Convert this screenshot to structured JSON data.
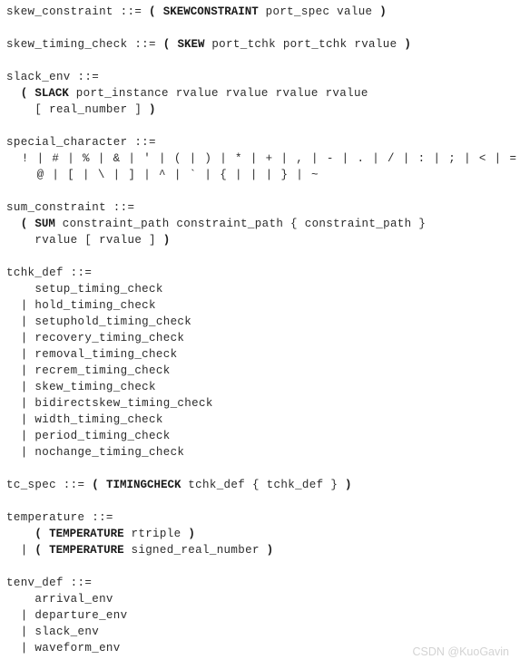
{
  "document": {
    "type": "bnf-grammar-listing",
    "watermark": "CSDN @KuoGavin",
    "text_color": "#2b2b2b",
    "keyword_color": "#1a1a1a",
    "background_color": "#ffffff",
    "lines": [
      {
        "id": "l1",
        "indent": 0,
        "segments": [
          {
            "t": "skew_constraint ::= ",
            "b": false
          },
          {
            "t": "(",
            "b": true
          },
          {
            "t": " ",
            "b": false
          },
          {
            "t": "SKEWCONSTRAINT",
            "b": true
          },
          {
            "t": " port_spec value ",
            "b": false
          },
          {
            "t": ")",
            "b": true
          }
        ]
      },
      {
        "id": "l2",
        "indent": 0,
        "segments": []
      },
      {
        "id": "l3",
        "indent": 0,
        "segments": [
          {
            "t": "skew_timing_check ::= ",
            "b": false
          },
          {
            "t": "(",
            "b": true
          },
          {
            "t": " ",
            "b": false
          },
          {
            "t": "SKEW",
            "b": true
          },
          {
            "t": " port_tchk port_tchk rvalue ",
            "b": false
          },
          {
            "t": ")",
            "b": true
          }
        ]
      },
      {
        "id": "l4",
        "indent": 0,
        "segments": []
      },
      {
        "id": "l5",
        "indent": 0,
        "segments": [
          {
            "t": "slack_env ::=",
            "b": false
          }
        ]
      },
      {
        "id": "l6",
        "indent": 0,
        "segments": [
          {
            "t": "  ",
            "b": false
          },
          {
            "t": "(",
            "b": true
          },
          {
            "t": " ",
            "b": false
          },
          {
            "t": "SLACK",
            "b": true
          },
          {
            "t": " port_instance rvalue rvalue rvalue rvalue",
            "b": false
          }
        ]
      },
      {
        "id": "l7",
        "indent": 0,
        "segments": [
          {
            "t": "    [ real_number ] ",
            "b": false
          },
          {
            "t": ")",
            "b": true
          }
        ]
      },
      {
        "id": "l8",
        "indent": 0,
        "segments": []
      },
      {
        "id": "l9",
        "indent": 0,
        "segments": [
          {
            "t": "special_character ::=",
            "b": false
          }
        ]
      },
      {
        "id": "l10",
        "indent": 0,
        "special": true,
        "segments": [
          {
            "t": "  ! | # | % | & | ' | ( | ) | * | + | , | - | . | / | : | ; | < | = | > | ? |",
            "b": false
          }
        ]
      },
      {
        "id": "l11",
        "indent": 0,
        "special": true,
        "segments": [
          {
            "t": "    @ | [ | \\ | ] | ^ | ` | { | | | } | ~",
            "b": false
          }
        ]
      },
      {
        "id": "l12",
        "indent": 0,
        "segments": []
      },
      {
        "id": "l13",
        "indent": 0,
        "segments": [
          {
            "t": "sum_constraint ::=",
            "b": false
          }
        ]
      },
      {
        "id": "l14",
        "indent": 0,
        "segments": [
          {
            "t": "  ",
            "b": false
          },
          {
            "t": "(",
            "b": true
          },
          {
            "t": " ",
            "b": false
          },
          {
            "t": "SUM",
            "b": true
          },
          {
            "t": " constraint_path constraint_path { constraint_path }",
            "b": false
          }
        ]
      },
      {
        "id": "l15",
        "indent": 0,
        "segments": [
          {
            "t": "    rvalue [ rvalue ] ",
            "b": false
          },
          {
            "t": ")",
            "b": true
          }
        ]
      },
      {
        "id": "l16",
        "indent": 0,
        "segments": []
      },
      {
        "id": "l17",
        "indent": 0,
        "segments": [
          {
            "t": "tchk_def ::=",
            "b": false
          }
        ]
      },
      {
        "id": "l18",
        "indent": 0,
        "segments": [
          {
            "t": "    setup_timing_check",
            "b": false
          }
        ]
      },
      {
        "id": "l19",
        "indent": 0,
        "segments": [
          {
            "t": "  | hold_timing_check",
            "b": false
          }
        ]
      },
      {
        "id": "l20",
        "indent": 0,
        "segments": [
          {
            "t": "  | setuphold_timing_check",
            "b": false
          }
        ]
      },
      {
        "id": "l21",
        "indent": 0,
        "segments": [
          {
            "t": "  | recovery_timing_check",
            "b": false
          }
        ]
      },
      {
        "id": "l22",
        "indent": 0,
        "segments": [
          {
            "t": "  | removal_timing_check",
            "b": false
          }
        ]
      },
      {
        "id": "l23",
        "indent": 0,
        "segments": [
          {
            "t": "  | recrem_timing_check",
            "b": false
          }
        ]
      },
      {
        "id": "l24",
        "indent": 0,
        "segments": [
          {
            "t": "  | skew_timing_check",
            "b": false
          }
        ]
      },
      {
        "id": "l25",
        "indent": 0,
        "segments": [
          {
            "t": "  | bidirectskew_timing_check",
            "b": false
          }
        ]
      },
      {
        "id": "l26",
        "indent": 0,
        "segments": [
          {
            "t": "  | width_timing_check",
            "b": false
          }
        ]
      },
      {
        "id": "l27",
        "indent": 0,
        "segments": [
          {
            "t": "  | period_timing_check",
            "b": false
          }
        ]
      },
      {
        "id": "l28",
        "indent": 0,
        "segments": [
          {
            "t": "  | nochange_timing_check",
            "b": false
          }
        ]
      },
      {
        "id": "l29",
        "indent": 0,
        "segments": []
      },
      {
        "id": "l30",
        "indent": 0,
        "segments": [
          {
            "t": "tc_spec ::= ",
            "b": false
          },
          {
            "t": "(",
            "b": true
          },
          {
            "t": " ",
            "b": false
          },
          {
            "t": "TIMINGCHECK",
            "b": true
          },
          {
            "t": " tchk_def { tchk_def } ",
            "b": false
          },
          {
            "t": ")",
            "b": true
          }
        ]
      },
      {
        "id": "l31",
        "indent": 0,
        "segments": []
      },
      {
        "id": "l32",
        "indent": 0,
        "segments": [
          {
            "t": "temperature ::=",
            "b": false
          }
        ]
      },
      {
        "id": "l33",
        "indent": 0,
        "segments": [
          {
            "t": "    ",
            "b": false
          },
          {
            "t": "(",
            "b": true
          },
          {
            "t": " ",
            "b": false
          },
          {
            "t": "TEMPERATURE",
            "b": true
          },
          {
            "t": " rtriple ",
            "b": false
          },
          {
            "t": ")",
            "b": true
          }
        ]
      },
      {
        "id": "l34",
        "indent": 0,
        "segments": [
          {
            "t": "  | ",
            "b": false
          },
          {
            "t": "(",
            "b": true
          },
          {
            "t": " ",
            "b": false
          },
          {
            "t": "TEMPERATURE",
            "b": true
          },
          {
            "t": " signed_real_number ",
            "b": false
          },
          {
            "t": ")",
            "b": true
          }
        ]
      },
      {
        "id": "l35",
        "indent": 0,
        "segments": []
      },
      {
        "id": "l36",
        "indent": 0,
        "segments": [
          {
            "t": "tenv_def ::=",
            "b": false
          }
        ]
      },
      {
        "id": "l37",
        "indent": 0,
        "segments": [
          {
            "t": "    arrival_env",
            "b": false
          }
        ]
      },
      {
        "id": "l38",
        "indent": 0,
        "segments": [
          {
            "t": "  | departure_env",
            "b": false
          }
        ]
      },
      {
        "id": "l39",
        "indent": 0,
        "segments": [
          {
            "t": "  | slack_env",
            "b": false
          }
        ]
      },
      {
        "id": "l40",
        "indent": 0,
        "segments": [
          {
            "t": "  | waveform_env",
            "b": false
          }
        ]
      }
    ]
  }
}
